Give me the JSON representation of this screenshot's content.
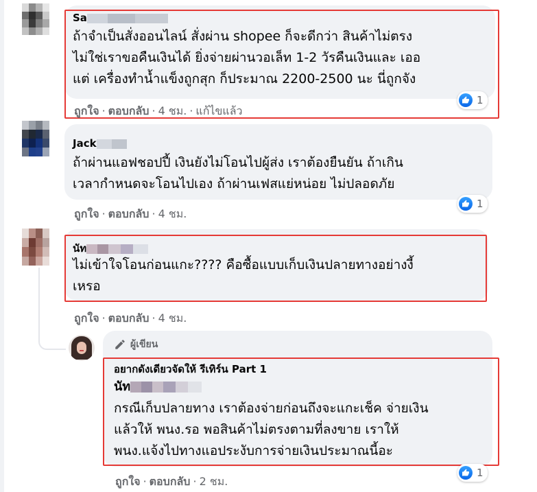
{
  "comments": [
    {
      "author": "Sa",
      "text_lines": [
        "ถ้าจำเป็นสั่งออนไลน์ สั่งผ่าน shopee ก็จะดีกว่า สินค้าไม่ตรง",
        "ไม่ใช่เราขอคืนเงินได้ ยิ่งจ่ายผ่านวอเล็ท 1-2 วัรคืนเงินและ เออ",
        "แต่ เครื่องทำน้ำแข็งถูกสุก ก็ประมาณ 2200-2500 นะ นี่ถูกจัง"
      ],
      "like_label": "ถูกใจ",
      "reply_label": "ตอบกลับ",
      "time": "4 ชม.",
      "edited": "แก้ไขแล้ว",
      "reaction_count": "1"
    },
    {
      "author": "Jack",
      "text_lines": [
        "ถ้าผ่านแอฟชอปปี้ เงินยังไม่โอนไปผู้ส่ง เราต้องยืนยัน ถ้าเกิน",
        "เวลากำหนดจะโอนไปเอง ถ้าผ่านเฟสแย่หน่อย ไม่ปลอดภัย"
      ],
      "like_label": "ถูกใจ",
      "reply_label": "ตอบกลับ",
      "time": "4 ชม.",
      "reaction_count": "1"
    },
    {
      "author": "นัท",
      "text_lines": [
        "ไม่เข้าใจโอนก่อนแกะ???? คือซื้อแบบเก็บเงินปลายทางอย่างงี้",
        "เหรอ"
      ],
      "like_label": "ถูกใจ",
      "reply_label": "ตอบกลับ",
      "time": "4 ชม."
    }
  ],
  "reply": {
    "badge": "ผู้เขียน",
    "author": "อยากดังเดียวจัดให้ รีเทิร์น Part 1",
    "mention": "นัท",
    "text_lines": [
      "กรณีเก็บปลายทาง เราต้องจ่ายก่อนถึงจะแกะเช็ค จ่ายเงิน",
      "แล้วให้ พนง.รอ พอสินค้าไม่ตรงตามที่ลงขาย เราให้",
      "พนง.แจ้งไปทางแอประงับการจ่ายเงินประมาณนี้อะ"
    ],
    "like_label": "ถูกใจ",
    "reply_label": "ตอบกลับ",
    "time": "2 ชม.",
    "reaction_count": "1"
  },
  "colors": {
    "bubble": "#f0f2f5",
    "highlight": "#e53935",
    "like_blue": "#1877f2",
    "meta_text": "#65676b"
  },
  "icons": [
    "like-icon",
    "pencil-icon"
  ]
}
